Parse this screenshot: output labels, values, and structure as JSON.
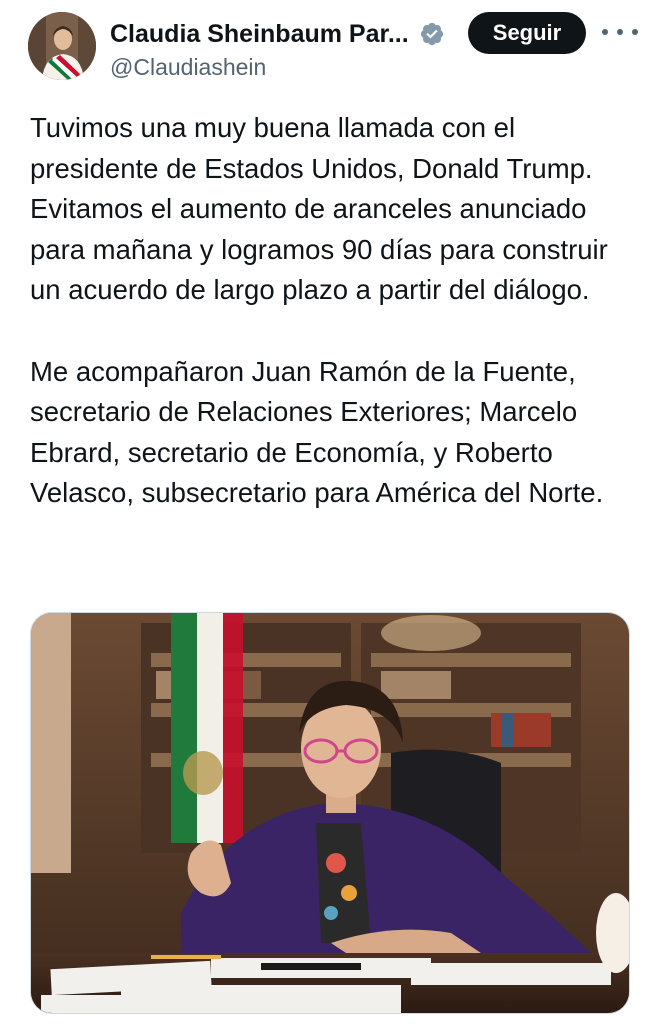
{
  "author": {
    "display_name": "Claudia Sheinbaum Par...",
    "handle": "@Claudiashein",
    "verified_icon": "verified-badge-icon",
    "avatar_icon": "avatar"
  },
  "actions": {
    "follow_label": "Seguir",
    "more_icon": "more-options-icon"
  },
  "post": {
    "paragraphs": [
      "Tuvimos una muy buena llamada con el presidente de Estados Unidos, Donald Trump. Evitamos el aumento de aranceles anunciado para mañana y logramos 90 días para construir un acuerdo de largo plazo a partir del diálogo.",
      "Me acompañaron Juan Ramón de la Fuente, secretario de Relaciones Exteriores; Marcelo Ebrard, secretario de Economía, y Roberto Velasco, subsecretario para América del Norte."
    ]
  },
  "colors": {
    "text": "#0f1419",
    "secondary_text": "#536471",
    "follow_bg": "#0f1419",
    "verified": "#829aab"
  }
}
